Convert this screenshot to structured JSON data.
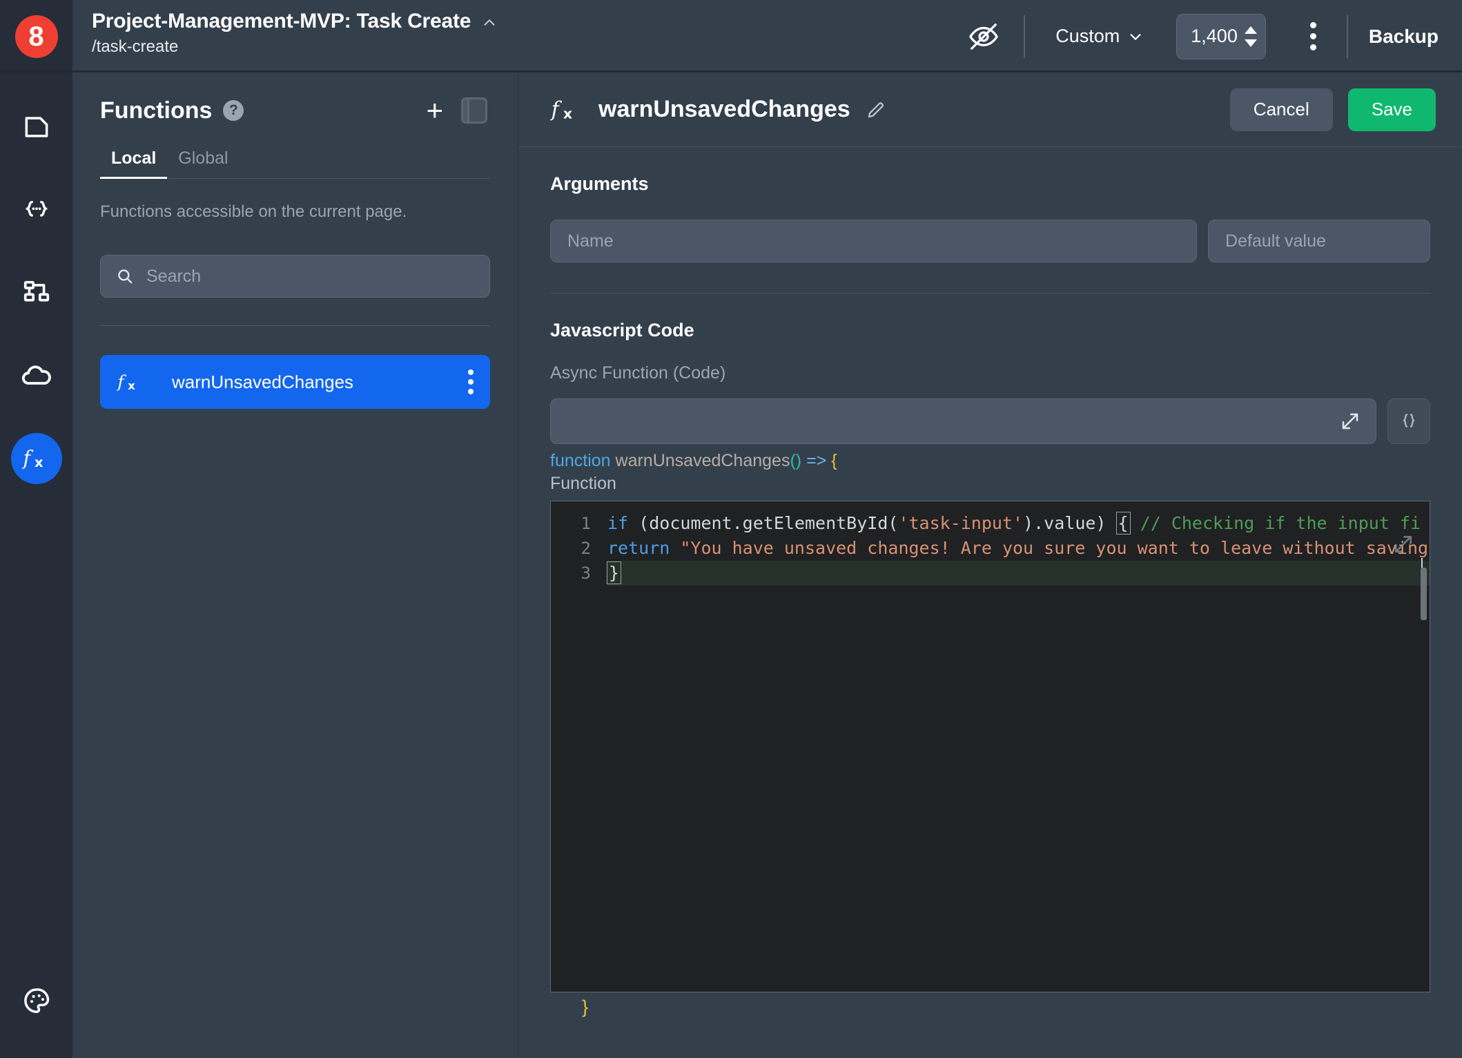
{
  "topbar": {
    "logo_text": "8",
    "title": "Project-Management-MVP: Task Create",
    "path": "/task-create",
    "collapse_icon": "chevron-up-icon",
    "preview_icon": "eye-off-icon",
    "viewport_mode": "Custom",
    "viewport_width": "1,400",
    "more_icon": "kebab-menu-icon",
    "backup_label": "Backup"
  },
  "rail": {
    "items": [
      {
        "icon": "page-icon",
        "active": false
      },
      {
        "icon": "json-braces-icon",
        "active": false
      },
      {
        "icon": "sitemap-icon",
        "active": false
      },
      {
        "icon": "cloud-icon",
        "active": false
      },
      {
        "icon": "function-fx-icon",
        "active": true
      }
    ],
    "bottom": {
      "icon": "palette-icon",
      "active": false
    }
  },
  "functions_panel": {
    "title": "Functions",
    "help_icon": "question-mark-icon",
    "add_icon": "plus-icon",
    "panel_toggle_icon": "side-panel-icon",
    "tabs": [
      {
        "label": "Local",
        "active": true
      },
      {
        "label": "Global",
        "active": false
      }
    ],
    "description": "Functions accessible on the current page.",
    "search": {
      "placeholder": "Search",
      "value": "",
      "icon": "search-icon"
    },
    "items": [
      {
        "name": "warnUnsavedChanges",
        "icon": "function-fx-icon",
        "menu_icon": "kebab-menu-icon",
        "selected": true
      }
    ]
  },
  "editor": {
    "function_icon": "function-fx-icon",
    "function_name": "warnUnsavedChanges",
    "edit_icon": "pencil-icon",
    "cancel_label": "Cancel",
    "save_label": "Save",
    "arguments": {
      "heading": "Arguments",
      "name_placeholder": "Name",
      "name_value": "",
      "default_placeholder": "Default value",
      "default_value": ""
    },
    "javascript": {
      "heading": "Javascript Code",
      "sub_label": "Async Function (Code)",
      "code_input_value": "",
      "expand_icon": "expand-arrows-icon",
      "braces_icon": "curly-braces-icon",
      "signature": {
        "keyword": "function",
        "name": "warnUnsavedChanges",
        "parens": "()",
        "arrow": "=>",
        "open_brace": "{"
      },
      "signature_label": "Function",
      "close_brace": "}",
      "code": {
        "line_numbers": [
          "1",
          "2",
          "3"
        ],
        "lines": [
          {
            "num": "1",
            "tokens": [
              {
                "t": "if",
                "c": "kw"
              },
              {
                "t": " (document.getElementById(",
                "c": "plain"
              },
              {
                "t": "'task-input'",
                "c": "str"
              },
              {
                "t": ").value) ",
                "c": "plain"
              },
              {
                "t": "{",
                "c": "plain-match"
              },
              {
                "t": "  // Checking if the input fi",
                "c": "com"
              }
            ]
          },
          {
            "num": "2",
            "tokens": [
              {
                "t": "return",
                "c": "kw"
              },
              {
                "t": " \"You have unsaved changes! Are you sure you want to leave without saving",
                "c": "str"
              }
            ]
          },
          {
            "num": "3",
            "tokens": [
              {
                "t": "}",
                "c": "plain-match"
              }
            ]
          }
        ]
      }
    }
  },
  "colors": {
    "accent_blue": "#1366ee",
    "save_green": "#0fb86e",
    "logo_red": "#ef3f32",
    "panel_bg": "#343f4c",
    "rail_bg": "#262d38",
    "editor_bg": "#1f2123"
  }
}
